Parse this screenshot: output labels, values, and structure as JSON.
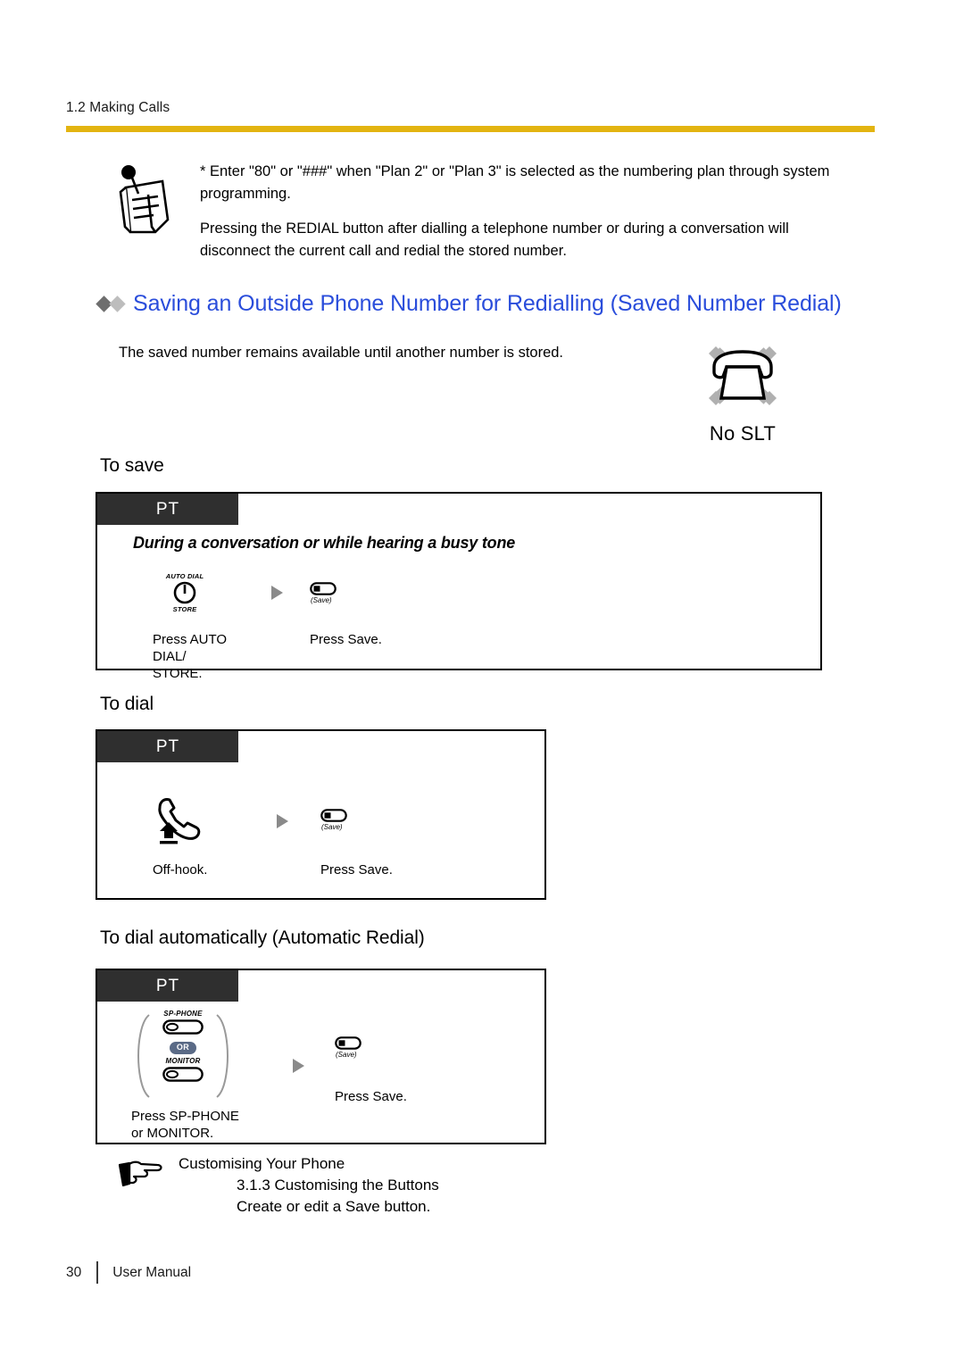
{
  "header": {
    "running_head": "1.2 Making Calls",
    "rule_color": "#e3b411"
  },
  "note": {
    "icon": "notepad-pin-icon",
    "paragraphs": [
      "* Enter \"80\" or \"###\" when \"Plan 2\" or \"Plan 3\" is selected as the numbering plan through system programming.",
      "Pressing the REDIAL button after dialling a telephone number or during a conversation will disconnect the current call and redial the stored number."
    ]
  },
  "section": {
    "heading": "Saving an Outside Phone Number for Redialling (Saved Number Redial)",
    "heading_color": "#2a4ddb",
    "bullet_colors": [
      "#6e6e6e",
      "#bdbdbd"
    ],
    "intro": "The saved number remains available until another number is stored."
  },
  "availability_badge": {
    "icon": "no-slt-phone-icon",
    "label": "No SLT"
  },
  "procedures": [
    {
      "id": "to-save",
      "sub_heading": "To save",
      "tab_label": "PT",
      "condition": "During a conversation or while hearing a busy tone",
      "steps": [
        {
          "icon": "auto-dial-store-button-icon",
          "icon_top_label": "AUTO DIAL",
          "icon_bottom_label": "STORE",
          "caption": "Press AUTO DIAL/\nSTORE."
        },
        {
          "icon": "save-button-icon",
          "icon_caption": "(Save)",
          "caption": "Press Save."
        }
      ]
    },
    {
      "id": "to-dial",
      "sub_heading": "To dial",
      "tab_label": "PT",
      "condition": "",
      "steps": [
        {
          "icon": "off-hook-handset-icon",
          "caption": "Off-hook."
        },
        {
          "icon": "save-button-icon",
          "icon_caption": "(Save)",
          "caption": "Press Save."
        }
      ]
    },
    {
      "id": "to-dial-automatically",
      "sub_heading": "To dial automatically (Automatic Redial)",
      "tab_label": "PT",
      "condition": "",
      "steps": [
        {
          "icon": "sp-phone-monitor-button-group-icon",
          "key_label_top": "SP-PHONE",
          "or_label": "OR",
          "key_label_bottom": "MONITOR",
          "caption": "Press SP-PHONE\nor MONITOR."
        },
        {
          "icon": "save-button-icon",
          "icon_caption": "(Save)",
          "caption": "Press Save."
        }
      ]
    }
  ],
  "cross_reference": {
    "icon": "pointing-hand-icon",
    "title": "Customising Your Phone",
    "details": "3.1.3 Customising the Buttons\nCreate or edit a Save button."
  },
  "footer": {
    "page_number": "30",
    "document_title": "User Manual"
  }
}
